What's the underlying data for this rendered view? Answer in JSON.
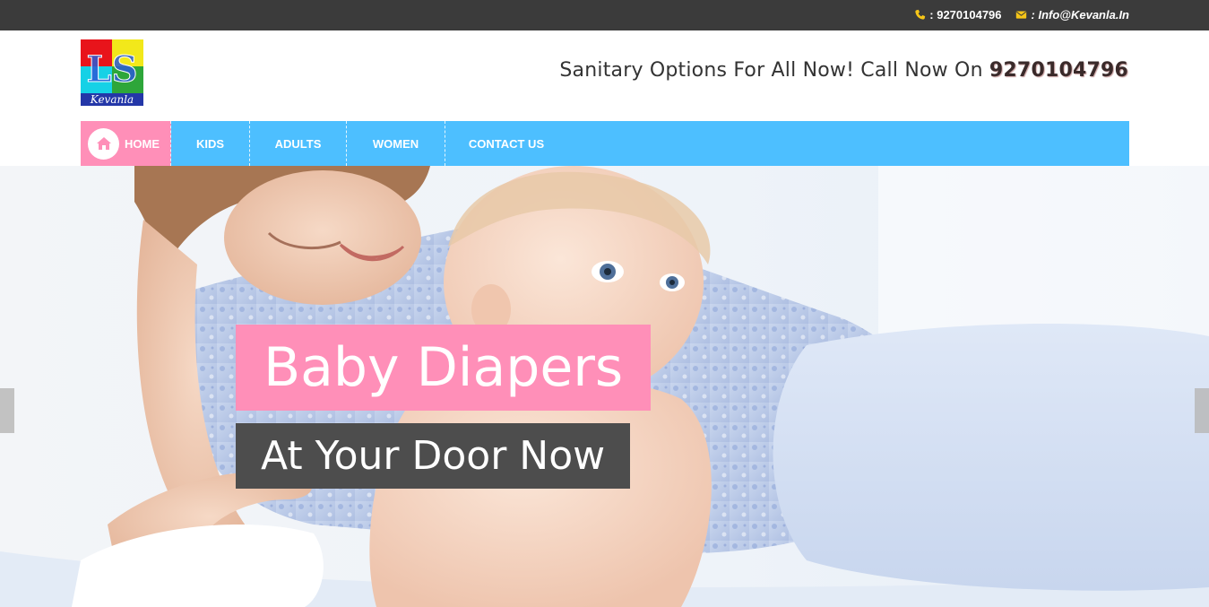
{
  "topbar": {
    "phone": ": 9270104796",
    "phone_icon": "phone-icon",
    "email": ": Info@Kevanla.In",
    "email_icon": "envelope-icon",
    "icon_color": "#f5c518"
  },
  "header": {
    "logo_text": "Kevanla",
    "logo_letters": "LS",
    "tagline_prefix": "Sanitary Options For All Now! Call Now On ",
    "tagline_phone": "9270104796"
  },
  "nav": {
    "items": [
      {
        "label": "HOME",
        "icon": "home-icon"
      },
      {
        "label": "KIDS"
      },
      {
        "label": "ADULTS"
      },
      {
        "label": "WOMEN"
      },
      {
        "label": "CONTACT US"
      }
    ],
    "bg_color": "#4dbfff",
    "active_color": "#ff8fb8"
  },
  "hero": {
    "caption_primary": "Baby Diapers",
    "caption_secondary": "At Your Door Now",
    "prev_control": "chevron-left-icon",
    "next_control": "chevron-right-icon"
  }
}
